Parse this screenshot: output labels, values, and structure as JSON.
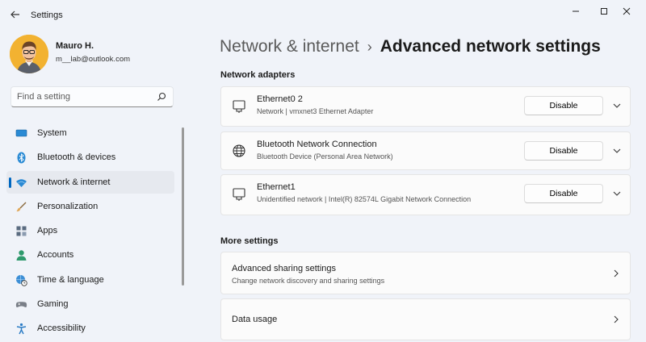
{
  "window": {
    "title": "Settings",
    "controls": [
      "minimize",
      "maximize",
      "close"
    ]
  },
  "profile": {
    "name": "Mauro H.",
    "email": "m__lab@outlook.com"
  },
  "search": {
    "placeholder": "Find a setting"
  },
  "sidebar": {
    "items": [
      {
        "label": "System",
        "icon": "monitor-icon",
        "active": false
      },
      {
        "label": "Bluetooth & devices",
        "icon": "bluetooth-icon",
        "active": false
      },
      {
        "label": "Network & internet",
        "icon": "wifi-icon",
        "active": true
      },
      {
        "label": "Personalization",
        "icon": "brush-icon",
        "active": false
      },
      {
        "label": "Apps",
        "icon": "apps-icon",
        "active": false
      },
      {
        "label": "Accounts",
        "icon": "person-icon",
        "active": false
      },
      {
        "label": "Time & language",
        "icon": "globe-clock-icon",
        "active": false
      },
      {
        "label": "Gaming",
        "icon": "gamepad-icon",
        "active": false
      },
      {
        "label": "Accessibility",
        "icon": "accessibility-icon",
        "active": false
      }
    ]
  },
  "breadcrumb": {
    "parent": "Network & internet",
    "separator": "›",
    "current": "Advanced network settings"
  },
  "adapters": {
    "section_title": "Network adapters",
    "items": [
      {
        "name": "Ethernet0 2",
        "description": "Network | vmxnet3 Ethernet Adapter",
        "button": "Disable",
        "icon": "ethernet-icon"
      },
      {
        "name": "Bluetooth Network Connection",
        "description": "Bluetooth Device (Personal Area Network)",
        "button": "Disable",
        "icon": "globe-icon"
      },
      {
        "name": "Ethernet1",
        "description": "Unidentified network | Intel(R) 82574L Gigabit Network Connection",
        "button": "Disable",
        "icon": "ethernet-icon"
      }
    ]
  },
  "more_settings": {
    "section_title": "More settings",
    "items": [
      {
        "title": "Advanced sharing settings",
        "description": "Change network discovery and sharing settings"
      },
      {
        "title": "Data usage",
        "description": ""
      }
    ]
  },
  "colors": {
    "accent": "#0067c0",
    "background": "#f0f3f9",
    "card": "#fbfbfb"
  }
}
